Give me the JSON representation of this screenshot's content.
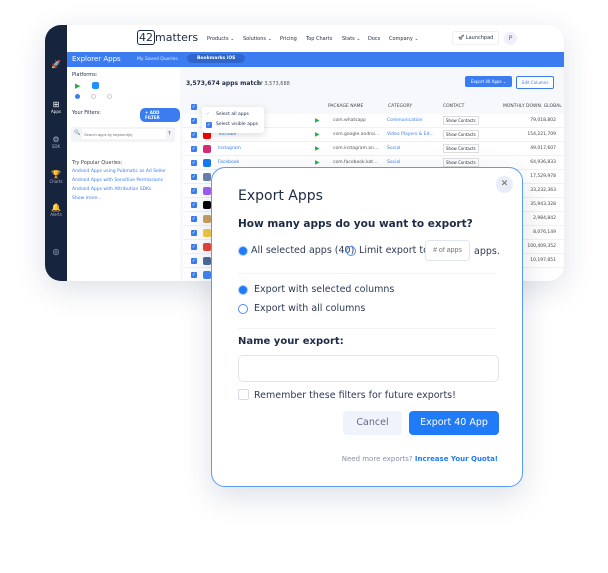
{
  "nav": {
    "logo": "42matters",
    "items": [
      "Products ⌄",
      "Solutions ⌄",
      "Pricing",
      "Top Charts",
      "Stats ⌄",
      "Docs",
      "Company ⌄"
    ],
    "launchpad": "Launchpad",
    "avatar": "P"
  },
  "sidebar": {
    "apps": "Apps",
    "sdk": "SDK",
    "charts": "Charts",
    "alerts": "Alerts"
  },
  "bluebar": {
    "title": "Explorer Apps",
    "saved": "My Saved Queries",
    "bookmark": "Bookmarks iOS"
  },
  "left": {
    "platforms": "Platforms:",
    "filters": "Your Filters:",
    "add_filter": "+ ADD FILTER",
    "search_placeholder": "Search apps by keyword(s)",
    "popular": "Try Popular Queries:",
    "queries": [
      "Android Apps using Pubmatic as Ad Seller",
      "Android Apps with Sensitive Permissions",
      "Android Apps with Attribution SDKs"
    ],
    "more": "Show more..."
  },
  "table": {
    "match": "3,573,674 apps match",
    "of": "of 3,573,688",
    "export_btn": "Export 40 Apps",
    "edit_btn": "Edit Columns",
    "cols": [
      "PACKAGE NAME",
      "CATEGORY",
      "CONTACT",
      "MONTHLY DOWN. GLOBAL"
    ],
    "select_all": "Select all apps",
    "select_visible": "Select visible apps",
    "show_contacts": "Show Contacts",
    "rows": [
      {
        "name": "",
        "pkg": "com.whatsapp",
        "cat": "Communication",
        "downloads": "79,018,802",
        "icon": "#25d366"
      },
      {
        "name": "YouTube",
        "pkg": "com.google.androi...",
        "cat": "Video Players & Ed...",
        "downloads": "154,221,709",
        "icon": "#ff0000"
      },
      {
        "name": "Instagram",
        "pkg": "com.instagram.an...",
        "cat": "Social",
        "downloads": "49,017,607",
        "icon": "#d62976"
      },
      {
        "name": "Facebook",
        "pkg": "com.facebook.kat...",
        "cat": "Social",
        "downloads": "64,936,833",
        "icon": "#1877f2"
      },
      {
        "name": "",
        "pkg": "",
        "cat": "",
        "downloads": "17,529,978",
        "icon": "#6a7fb0"
      },
      {
        "name": "",
        "pkg": "",
        "cat": "",
        "downloads": "33,232,363",
        "icon": "#a35cf5"
      },
      {
        "name": "",
        "pkg": "",
        "cat": "",
        "downloads": "35,943,328",
        "icon": "#000000"
      },
      {
        "name": "",
        "pkg": "",
        "cat": "",
        "downloads": "2,984,842",
        "icon": "#c9a060"
      },
      {
        "name": "",
        "pkg": "",
        "cat": "",
        "downloads": "8,076,149",
        "icon": "#f5c842"
      },
      {
        "name": "",
        "pkg": "",
        "cat": "",
        "downloads": "100,409,352",
        "icon": "#ea4335"
      },
      {
        "name": "",
        "pkg": "",
        "cat": "",
        "downloads": "10,197,851",
        "icon": "#4a6a9a"
      },
      {
        "name": "",
        "pkg": "",
        "cat": "",
        "downloads": "",
        "icon": "#4285f4"
      }
    ]
  },
  "modal": {
    "title": "Export Apps",
    "question": "How many apps do you want to export?",
    "all_selected": "All selected apps (40)",
    "limit": "Limit export to",
    "limit_placeholder": "# of apps",
    "apps_suffix": "apps.",
    "opt_selected": "Export with selected columns",
    "opt_all": "Export with all columns",
    "name_label": "Name your export:",
    "name_value": "",
    "remember": "Remember these filters for future exports!",
    "cancel": "Cancel",
    "export": "Export 40 App",
    "need_more": "Need more exports?",
    "quota": "Increase Your Quota!"
  }
}
